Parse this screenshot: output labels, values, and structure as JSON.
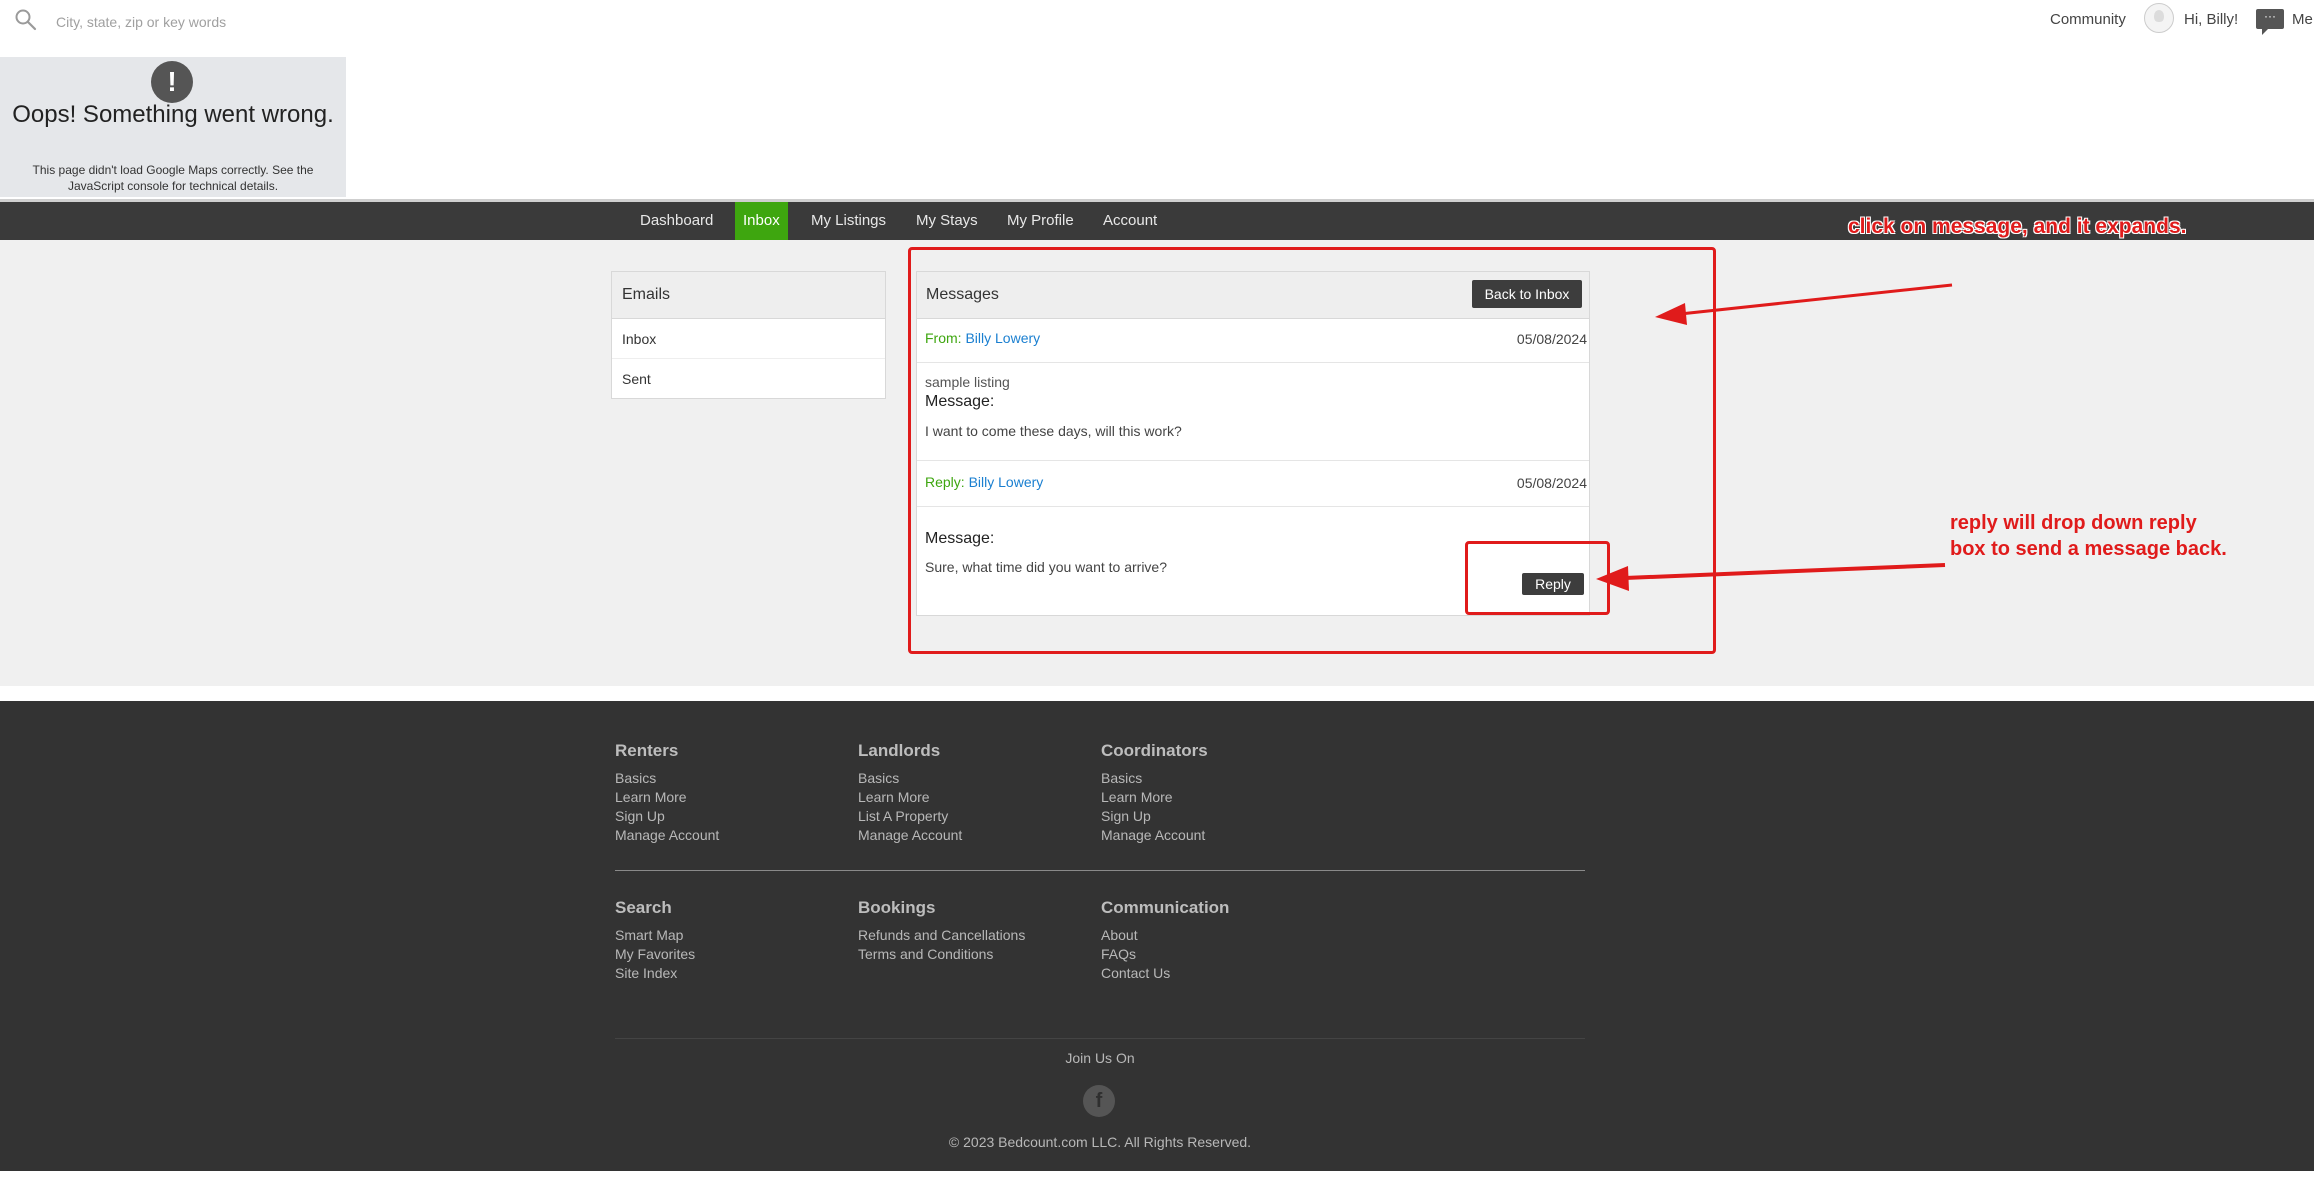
{
  "header": {
    "search_placeholder": "City, state, zip or key words",
    "community": "Community",
    "greeting": "Hi, Billy!",
    "messages_icon_glyph": "···",
    "messages_label": "Me"
  },
  "map_error": {
    "icon": "!",
    "title": "Oops! Something went wrong.",
    "description": "This page didn't load Google Maps correctly. See the JavaScript console for technical details."
  },
  "nav": {
    "items": [
      "Dashboard",
      "Inbox",
      "My Listings",
      "My Stays",
      "My Profile",
      "Account"
    ],
    "active": "Inbox",
    "active_color": "#3ea60f"
  },
  "emails": {
    "title": "Emails",
    "items": [
      "Inbox",
      "Sent"
    ]
  },
  "messages": {
    "title": "Messages",
    "back_button": "Back to Inbox",
    "from": {
      "label": "From:",
      "name": "Billy Lowery",
      "date": "05/08/2024"
    },
    "subject": "sample listing",
    "message_label": "Message:",
    "message_body": "I want to come these days, will this work?",
    "reply": {
      "label": "Reply:",
      "name": "Billy Lowery",
      "date": "05/08/2024"
    },
    "reply_message_label": "Message:",
    "reply_body": "Sure, what time did you want to arrive?",
    "reply_button": "Reply"
  },
  "annotations": {
    "note1": "click on message, and it expands.",
    "note2_line1": "reply will drop down reply",
    "note2_line2": "box to send a message back.",
    "color": "#e01b1b"
  },
  "footer": {
    "columns": [
      {
        "title": "Renters",
        "links": [
          "Basics",
          "Learn More",
          "Sign Up",
          "Manage Account"
        ]
      },
      {
        "title": "Landlords",
        "links": [
          "Basics",
          "Learn More",
          "List A Property",
          "Manage Account"
        ]
      },
      {
        "title": "Coordinators",
        "links": [
          "Basics",
          "Learn More",
          "Sign Up",
          "Manage Account"
        ]
      },
      {
        "title": "Search",
        "links": [
          "Smart Map",
          "My Favorites",
          "Site Index"
        ]
      },
      {
        "title": "Bookings",
        "links": [
          "Refunds and Cancellations",
          "Terms and Conditions"
        ]
      },
      {
        "title": "Communication",
        "links": [
          "About",
          "FAQs",
          "Contact Us"
        ]
      }
    ],
    "join": "Join Us On",
    "facebook_glyph": "f",
    "copyright": "© 2023 Bedcount.com LLC. All Rights Reserved."
  }
}
